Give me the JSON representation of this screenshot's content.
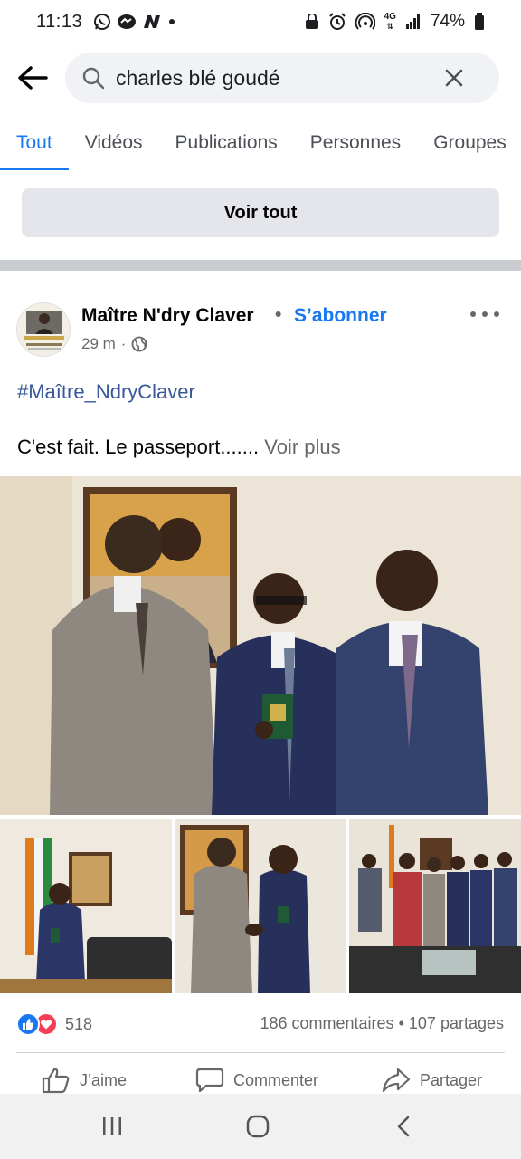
{
  "status_bar": {
    "time": "11:13",
    "network": "4G",
    "battery": "74%"
  },
  "search": {
    "query": "charles blé goudé"
  },
  "tabs": [
    {
      "label": "Tout",
      "active": true
    },
    {
      "label": "Vidéos",
      "active": false
    },
    {
      "label": "Publications",
      "active": false
    },
    {
      "label": "Personnes",
      "active": false
    },
    {
      "label": "Groupes",
      "active": false
    }
  ],
  "see_all_label": "Voir tout",
  "post": {
    "author": "Maître N'dry Claver",
    "separator": "•",
    "follow_label": "S’abonner",
    "time": "29 m",
    "meta_separator": "·",
    "hashtag": "#Maître_NdryClaver",
    "text": "C'est fait. Le passeport.......",
    "see_more": "Voir plus",
    "reaction_count": "518",
    "comments": "186 commentaires",
    "stats_separator": "•",
    "shares": "107 partages",
    "actions": {
      "like": "J’aime",
      "comment": "Commenter",
      "share": "Partager"
    }
  },
  "colors": {
    "accent": "#1877f2",
    "hashtag": "#385898",
    "like": "#1877f2",
    "love": "#f33e58"
  }
}
